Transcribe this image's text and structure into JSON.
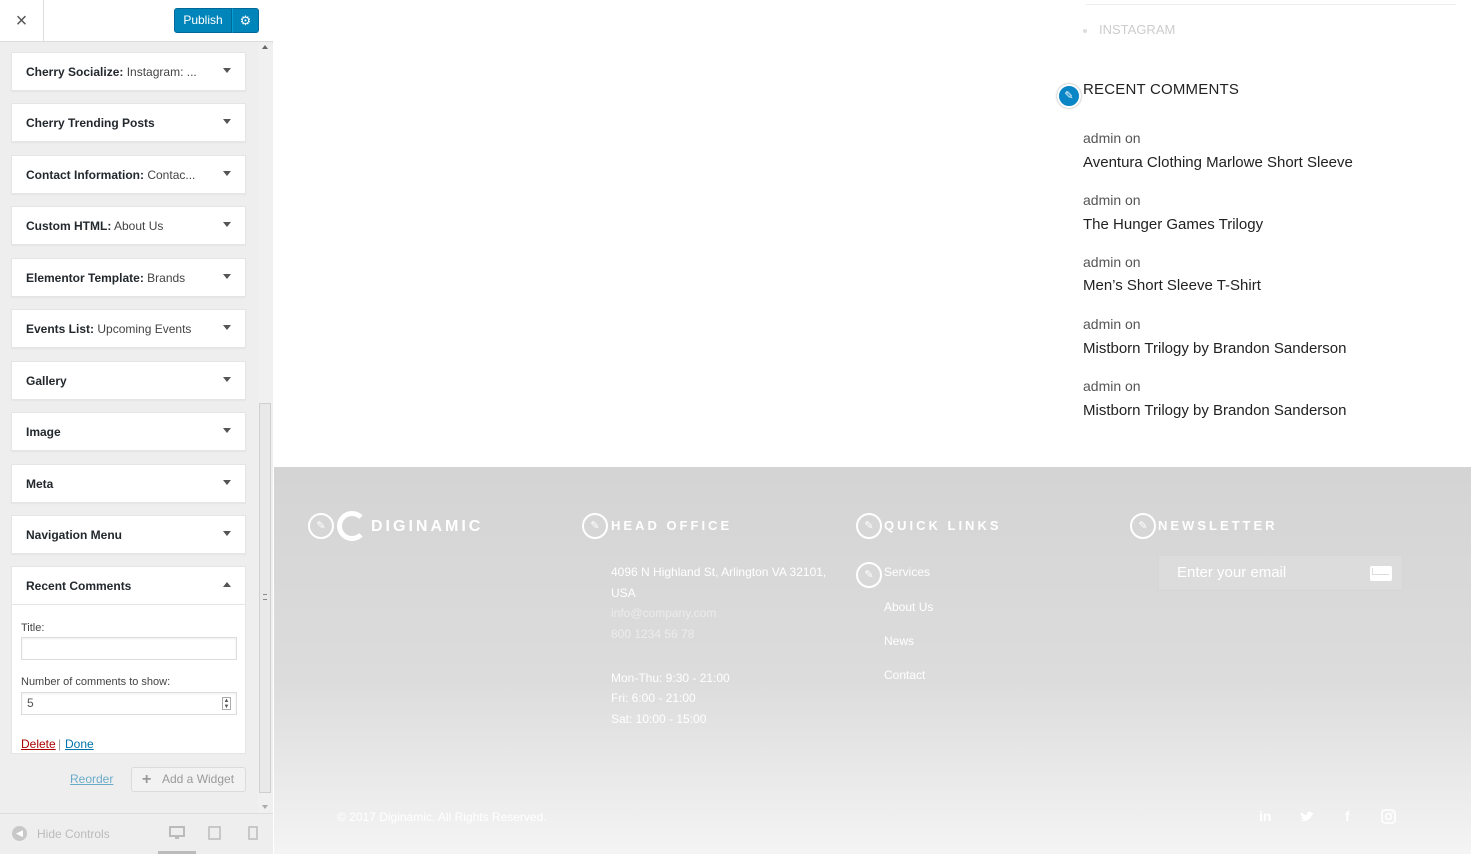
{
  "customizer": {
    "close_icon": "×",
    "publish_label": "Publish",
    "settings_icon": "⚙",
    "widgets": [
      {
        "name": "Cherry Socialize",
        "sub": "Instagram: ..."
      },
      {
        "name": "Cherry Trending Posts",
        "sub": ""
      },
      {
        "name": "Contact Information",
        "sub": "Contac..."
      },
      {
        "name": "Custom HTML",
        "sub": "About Us"
      },
      {
        "name": "Elementor Template",
        "sub": "Brands"
      },
      {
        "name": "Events List",
        "sub": "Upcoming Events"
      },
      {
        "name": "Gallery",
        "sub": ""
      },
      {
        "name": "Image",
        "sub": ""
      },
      {
        "name": "Meta",
        "sub": ""
      },
      {
        "name": "Navigation Menu",
        "sub": ""
      }
    ],
    "recent_comments_widget": {
      "name": "Recent Comments",
      "title_label": "Title:",
      "title_value": "",
      "count_label": "Number of comments to show:",
      "count_value": "5",
      "delete_label": "Delete",
      "separator": "|",
      "done_label": "Done"
    },
    "reorder_label": "Reorder",
    "add_widget_icon": "+",
    "add_widget_label": "Add a Widget",
    "hide_controls_label": "Hide Controls",
    "device_icons": [
      "desktop-icon",
      "tablet-icon",
      "mobile-icon"
    ]
  },
  "preview": {
    "instagram_label": "INSTAGRAM",
    "recent_comments_heading": "RECENT COMMENTS",
    "comments": [
      {
        "author": "admin on",
        "post": "Aventura Clothing Marlowe Short Sleeve"
      },
      {
        "author": "admin on",
        "post": "The Hunger Games Trilogy"
      },
      {
        "author": "admin on",
        "post": "Men’s Short Sleeve T-Shirt"
      },
      {
        "author": "admin on",
        "post": "Mistborn Trilogy by Brandon Sanderson"
      },
      {
        "author": "admin on",
        "post": "Mistborn Trilogy by Brandon Sanderson"
      }
    ],
    "footer": {
      "logo_text": "DIGINAMIC",
      "head_office_heading": "HEAD OFFICE",
      "address": "4096 N Highland St, Arlington VA 32101, USA",
      "email": "info@company.com",
      "phone": "800 1234 56 78",
      "hours": [
        "Mon-Thu: 9:30 - 21:00",
        "Fri: 6:00 - 21:00",
        "Sat: 10:00 - 15:00"
      ],
      "quick_links_heading": "QUICK LINKS",
      "quick_links": [
        "Services",
        "About Us",
        "News",
        "Contact"
      ],
      "newsletter_heading": "NEWSLETTER",
      "newsletter_placeholder": "Enter your email",
      "copyright": "© 2017 Diginamic. All Rights Reserved.",
      "social": [
        "in",
        "twitter-icon",
        "f",
        "instagram-icon"
      ]
    }
  },
  "colors": {
    "publish_blue": "#0085ba",
    "edit_shortcut_blue": "#0a85c6",
    "delete_red": "#a00",
    "link_blue": "#0073aa"
  }
}
